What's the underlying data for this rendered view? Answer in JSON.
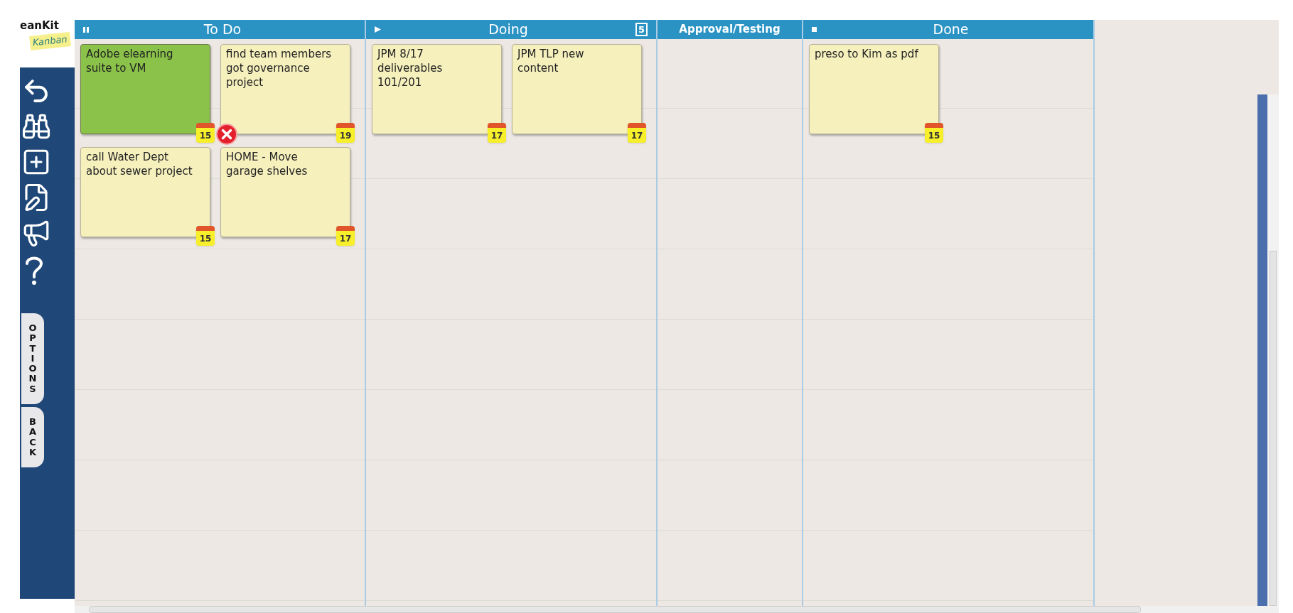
{
  "logo": {
    "title": "eanKit",
    "subtitle": "Kanban"
  },
  "side_tabs": [
    "OPTIONS",
    "BACK"
  ],
  "columns": [
    {
      "title": "To Do",
      "kind": "pause",
      "cards": [
        {
          "text": "Adobe elearning suite to VM",
          "date": "15",
          "color": "#8bc34a",
          "delete_visible": true
        },
        {
          "text": "find team members got governance project",
          "date": "19",
          "color": "#f6f0bd",
          "delete_visible": false
        },
        {
          "text": "call Water Dept about sewer project",
          "date": "15",
          "color": "#f6f0bd",
          "delete_visible": false
        },
        {
          "text": "HOME - Move garage shelves",
          "date": "17",
          "color": "#f6f0bd",
          "delete_visible": false
        }
      ]
    },
    {
      "title": "Doing",
      "kind": "play",
      "wip_limit": "5",
      "cards": [
        {
          "text": "JPM 8/17 deliverables 101/201",
          "date": "17",
          "color": "#f6f0bd",
          "delete_visible": false
        },
        {
          "text": "JPM TLP new content",
          "date": "17",
          "color": "#f6f0bd",
          "delete_visible": false
        }
      ]
    },
    {
      "title": "Approval/Testing",
      "kind": "none"
    },
    {
      "title": "Done",
      "kind": "stop",
      "cards": [
        {
          "text": "preso to Kim as pdf",
          "date": "15",
          "color": "#f6f0bd",
          "delete_visible": false
        }
      ]
    }
  ]
}
